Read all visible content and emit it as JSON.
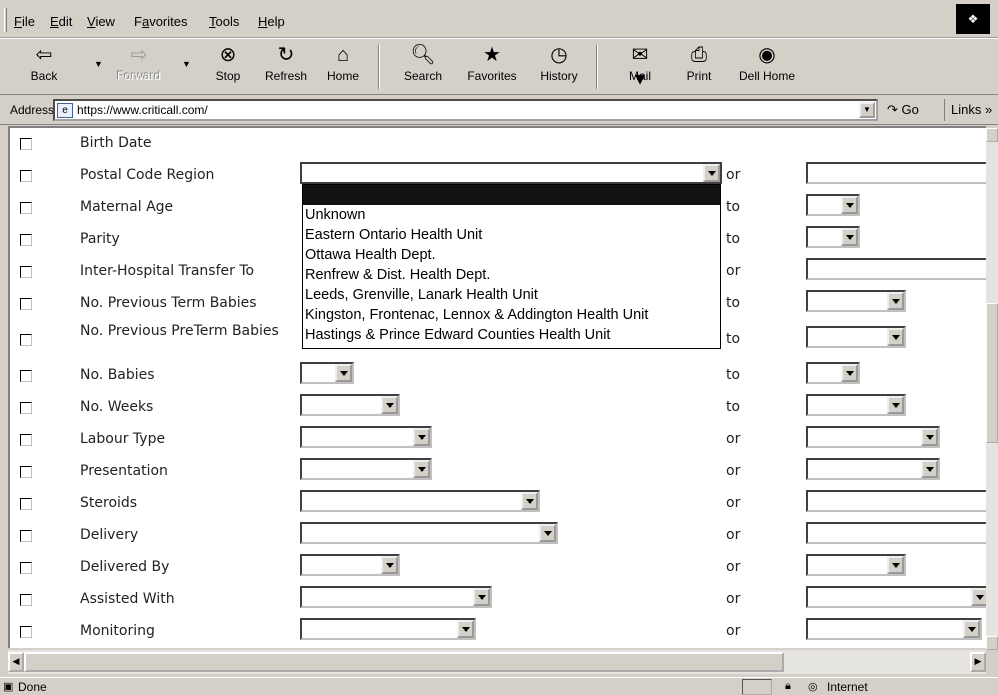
{
  "menu": {
    "items": [
      "File",
      "Edit",
      "View",
      "Favorites",
      "Tools",
      "Help"
    ],
    "accelerators": [
      "F",
      "E",
      "V",
      "a",
      "T",
      "H"
    ]
  },
  "toolbar": {
    "buttons": [
      {
        "label": "Back",
        "icon": "back-arrow-icon",
        "enabled": true
      },
      {
        "label": "Forward",
        "icon": "forward-arrow-icon",
        "enabled": false
      },
      {
        "label": "Stop",
        "icon": "stop-icon",
        "enabled": true
      },
      {
        "label": "Refresh",
        "icon": "refresh-icon",
        "enabled": true
      },
      {
        "label": "Home",
        "icon": "home-icon",
        "enabled": true
      },
      {
        "label": "Search",
        "icon": "search-icon",
        "enabled": true
      },
      {
        "label": "Favorites",
        "icon": "favorites-icon",
        "enabled": true
      },
      {
        "label": "History",
        "icon": "history-icon",
        "enabled": true
      },
      {
        "label": "Mail",
        "icon": "mail-icon",
        "enabled": true
      },
      {
        "label": "Print",
        "icon": "print-icon",
        "enabled": true
      },
      {
        "label": "Dell Home",
        "icon": "dell-home-icon",
        "enabled": true
      }
    ]
  },
  "address": {
    "label": "Address",
    "url": "https://www.criticall.com/",
    "go_label": "Go",
    "links_label": "Links"
  },
  "form": {
    "rows": [
      {
        "label": "Birth Date",
        "conj": ""
      },
      {
        "label": "Postal Code Region",
        "conj": "or"
      },
      {
        "label": "Maternal Age",
        "conj": "to"
      },
      {
        "label": "Parity",
        "conj": "to"
      },
      {
        "label": "Inter-Hospital Transfer To",
        "conj": "or"
      },
      {
        "label": "No. Previous Term Babies",
        "conj": "to"
      },
      {
        "label": "No. Previous PreTerm Babies",
        "conj": "to"
      },
      {
        "label": "No. Babies",
        "conj": "to"
      },
      {
        "label": "No. Weeks",
        "conj": "to"
      },
      {
        "label": "Labour Type",
        "conj": "or"
      },
      {
        "label": "Presentation",
        "conj": "or"
      },
      {
        "label": "Steroids",
        "conj": "or"
      },
      {
        "label": "Delivery",
        "conj": "or"
      },
      {
        "label": "Delivered By",
        "conj": "or"
      },
      {
        "label": "Assisted With",
        "conj": "or"
      },
      {
        "label": "Monitoring",
        "conj": "or"
      }
    ]
  },
  "dropdown": {
    "field": "Postal Code Region",
    "options": [
      "",
      "Unknown",
      "Eastern Ontario Health Unit",
      "Ottawa Health Dept.",
      "Renfrew & Dist. Health Dept.",
      "Leeds, Grenville, Lanark Health Unit",
      "Kingston, Frontenac, Lennox & Addington Health Unit",
      "Hastings & Prince Edward Counties Health Unit"
    ],
    "highlighted_index": 0
  },
  "status": {
    "text": "Done",
    "zone": "Internet"
  }
}
